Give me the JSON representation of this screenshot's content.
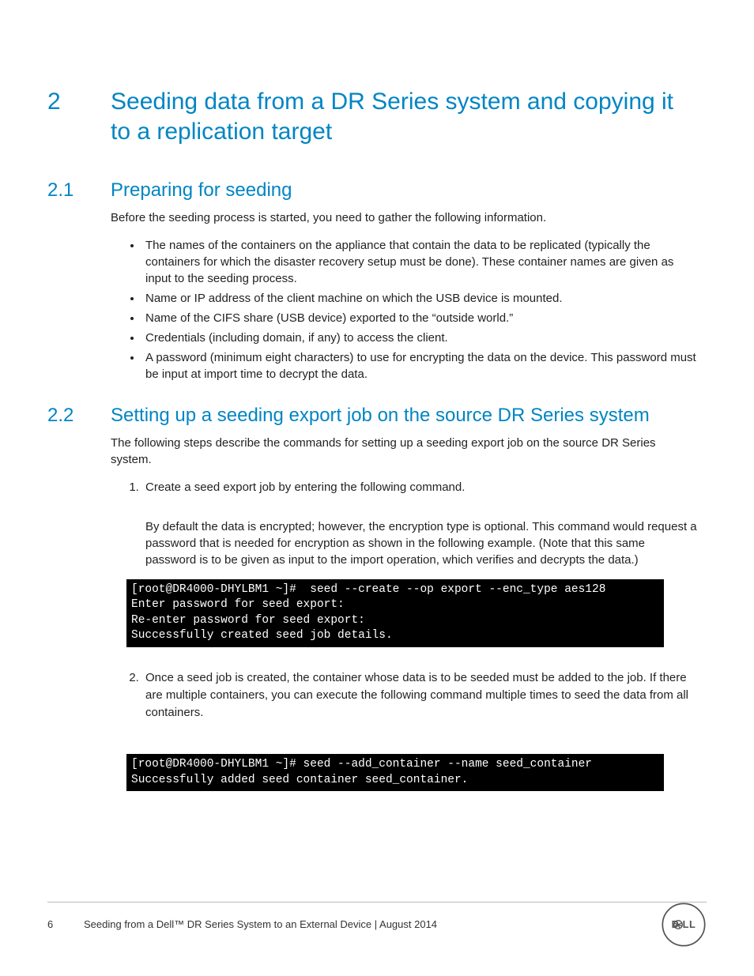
{
  "section": {
    "number": "2",
    "title": "Seeding data from a DR Series system and copying it to a replication target"
  },
  "sub1": {
    "number": "2.1",
    "title": "Preparing for seeding",
    "intro": "Before the seeding process is started, you need to gather the following information.",
    "bullets": [
      "The names of the containers on the appliance that contain the data to be replicated (typically the containers for which the disaster recovery setup must be done). These container names are given as input to the seeding process.",
      "Name or IP address of the client machine on which the USB device is mounted.",
      "Name of the CIFS share (USB device) exported to the “outside world.”",
      "Credentials (including domain, if any) to access the client.",
      "A password (minimum eight characters) to use for encrypting the data on the device. This password must be input at import time to decrypt the data."
    ]
  },
  "sub2": {
    "number": "2.2",
    "title": "Setting up a seeding export job on the source DR Series system",
    "intro": "The following steps describe the commands for setting up a seeding export job on the source DR Series system.",
    "step1": {
      "text": "Create a seed export job by entering the following command.",
      "note": "By default the data is encrypted; however, the encryption type is optional. This command would request a password that is needed for encryption as shown in the following example. (Note that this same password is to be given as input to the import operation, which verifies and decrypts the data.)",
      "term": "[root@DR4000-DHYLBM1 ~]#  seed --create --op export --enc_type aes128\nEnter password for seed export:\nRe-enter password for seed export:\nSuccessfully created seed job details."
    },
    "step2": {
      "text": "Once a seed job is created, the container whose data is to be seeded must be added to the job. If there are multiple containers, you can execute the following command multiple times to seed the data from all containers.",
      "term": "[root@DR4000-DHYLBM1 ~]# seed --add_container --name seed_container\nSuccessfully added seed container seed_container."
    }
  },
  "footer": {
    "page": "6",
    "title": "Seeding from a Dell™ DR Series System to an External Device | August 2014"
  }
}
